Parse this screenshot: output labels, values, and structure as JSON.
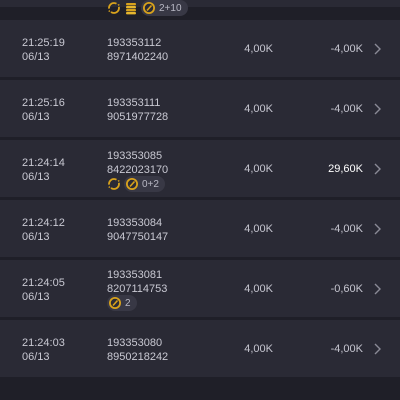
{
  "rows": [
    {
      "time": "",
      "date": "",
      "id": "",
      "code": "",
      "amount": "",
      "result": "",
      "result_color": "",
      "badges": {
        "icons": [
          "refresh-icon",
          "coins-stack-icon",
          "wild-icon"
        ],
        "count": "2+10"
      }
    },
    {
      "time": "21:25:19",
      "date": "06/13",
      "id": "193353112",
      "code": "8971402240",
      "amount": "4,00K",
      "result": "-4,00K"
    },
    {
      "time": "21:25:16",
      "date": "06/13",
      "id": "193353111",
      "code": "9051977728",
      "amount": "4,00K",
      "result": "-4,00K"
    },
    {
      "time": "21:24:14",
      "date": "06/13",
      "id": "193353085",
      "code": "8422023170",
      "amount": "4,00K",
      "result": "29,60K",
      "result_color": "#ffffff",
      "badges": {
        "icons": [
          "refresh-icon",
          "wild-icon"
        ],
        "count": "0+2"
      }
    },
    {
      "time": "21:24:12",
      "date": "06/13",
      "id": "193353084",
      "code": "9047750147",
      "amount": "4,00K",
      "result": "-4,00K"
    },
    {
      "time": "21:24:05",
      "date": "06/13",
      "id": "193353081",
      "code": "8207114753",
      "amount": "4,00K",
      "result": "-0,60K",
      "badges": {
        "icons": [
          "wild-icon"
        ],
        "count": "2"
      }
    },
    {
      "time": "21:24:03",
      "date": "06/13",
      "id": "193353080",
      "code": "8950218242",
      "amount": "4,00K",
      "result": "-4,00K"
    }
  ],
  "colors": {
    "background": "#1f1f28",
    "row": "#2a2a35",
    "badge_gold": "#d8a21c",
    "text": "#c6c6d0",
    "win": "#ffffff"
  }
}
